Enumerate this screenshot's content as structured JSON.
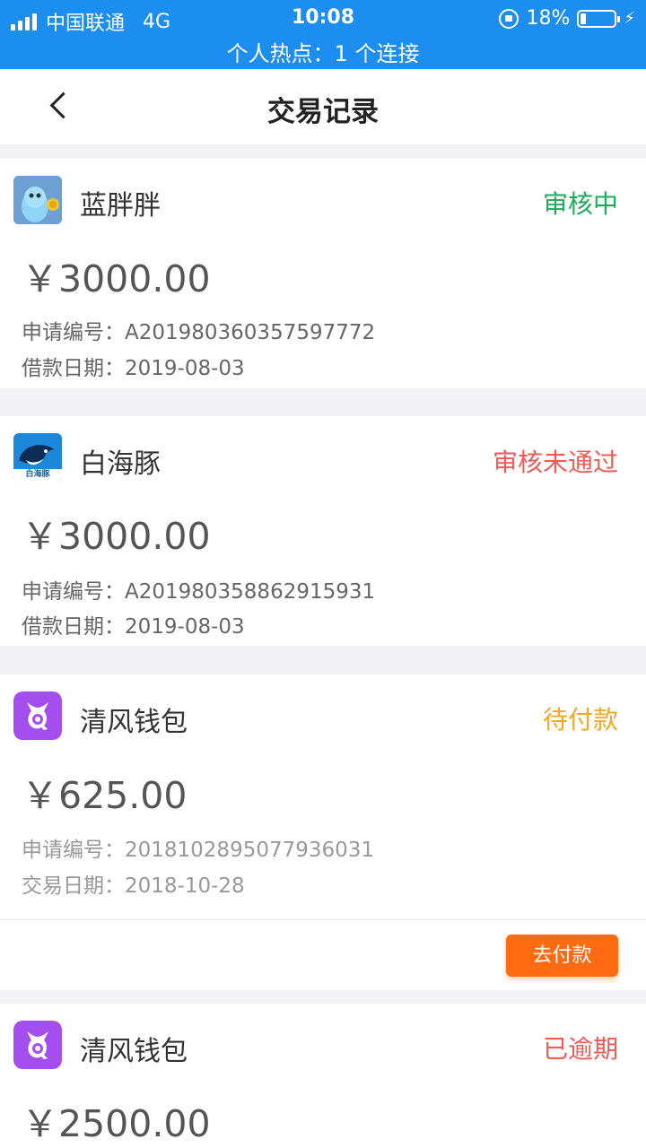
{
  "status_bar": {
    "carrier": "中国联通",
    "network": "4G",
    "time": "10:08",
    "battery": "18%",
    "battery_level": 0.18,
    "hotspot": "个人热点：1 个连接",
    "background_color": "#1c8ef0"
  },
  "nav": {
    "title": "交易记录",
    "back_icon": "chevron-left-icon"
  },
  "colors": {
    "approved_pending": "#1aad5b",
    "rejected": "#f25b53",
    "awaiting_payment": "#f5a623",
    "overdue": "#f25b53",
    "pay_button": "#ff6a13"
  },
  "records": [
    {
      "app_name": "蓝胖胖",
      "app_icon": "blue-mascot-logo",
      "status": "审核中",
      "status_color": "#1aad5b",
      "amount": "￥3000.00",
      "id_label": "申请编号：",
      "id_value": "A201980360357597772",
      "date_label": "借款日期：",
      "date_value": "2019-08-03"
    },
    {
      "app_name": "白海豚",
      "app_icon": "dolphin-logo",
      "icon_caption": "白海豚",
      "status": "审核未通过",
      "status_color": "#f25b53",
      "amount": "￥3000.00",
      "id_label": "申请编号：",
      "id_value": "A201980358862915931",
      "date_label": "借款日期：",
      "date_value": "2019-08-03"
    },
    {
      "app_name": "清风钱包",
      "app_icon": "purple-q-logo",
      "status": "待付款",
      "status_color": "#f5a623",
      "amount": "￥625.00",
      "id_label": "申请编号：",
      "id_value": "2018102895077936031",
      "date_label": "交易日期：",
      "date_value": "2018-10-28",
      "action_label": "去付款"
    },
    {
      "app_name": "清风钱包",
      "app_icon": "purple-q-logo",
      "status": "已逾期",
      "status_color": "#f25b53",
      "amount": "￥2500.00"
    }
  ]
}
